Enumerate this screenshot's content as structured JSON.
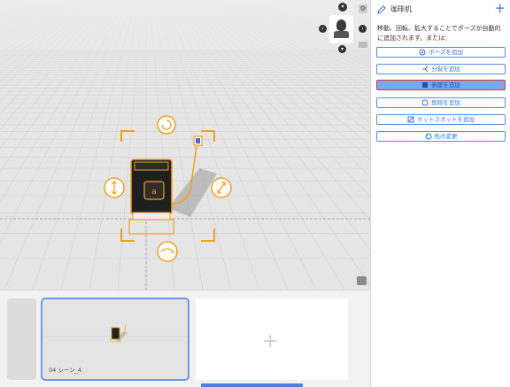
{
  "sidebar": {
    "title": "珈琲机",
    "add_label": "+",
    "description": "移動、回転、拡大することでポーズが自動的に追加されます。または：",
    "actions": [
      {
        "label": "ポーズを追加",
        "icon": "pose-icon",
        "selected": false
      },
      {
        "label": "分裂を追加",
        "icon": "split-icon",
        "selected": false
      },
      {
        "label": "剥層を追加",
        "icon": "layer-icon",
        "selected": true
      },
      {
        "label": "削除を追加",
        "icon": "remove-icon",
        "selected": false
      },
      {
        "label": "ホットスポットを追加",
        "icon": "hotspot-icon",
        "selected": false
      },
      {
        "label": "色の変更",
        "icon": "palette-icon",
        "selected": false
      }
    ]
  },
  "filmstrip": {
    "scenes": [
      {
        "label": "04 シーン_4",
        "selected": true
      }
    ],
    "new_scene_label": "+"
  },
  "colors": {
    "accent": "#3b6fd0",
    "gizmo": "#f0a020",
    "selected_border": "#c5394a"
  }
}
